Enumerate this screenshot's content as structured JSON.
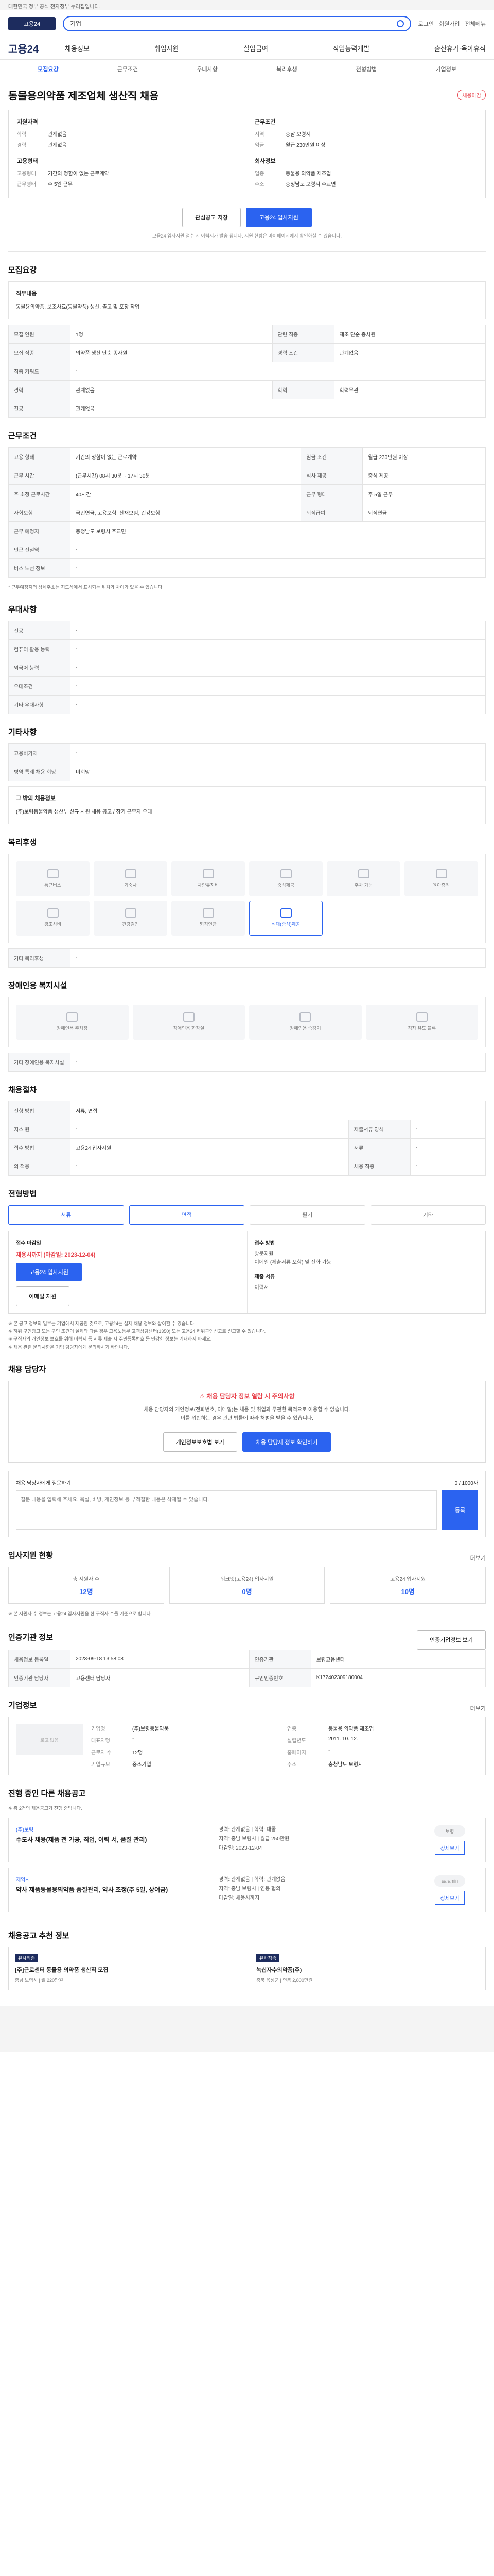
{
  "topbar": {
    "text": "대한민국 정부 공식 전자정부 누리집입니다."
  },
  "header": {
    "logo": "고용24",
    "search_value": "기업",
    "links": [
      "로그인",
      "회원가입",
      "전체메뉴"
    ]
  },
  "gnb": {
    "brand": "고용24",
    "menu": [
      "채용정보",
      "취업지원",
      "실업급여",
      "직업능력개발",
      "출산휴가·육아휴직"
    ]
  },
  "subnav": [
    "모집요강",
    "근무조건",
    "우대사항",
    "복리후생",
    "전형방법",
    "기업정보"
  ],
  "job": {
    "title": "동물용의약품 제조업체 생산직 채용",
    "badge": "채용마감",
    "company": {
      "label1": "지원자격",
      "edu_k": "학력",
      "edu_v": "관계없음",
      "career_k": "경력",
      "career_v": "관계없음",
      "label2": "근무조건",
      "region_k": "지역",
      "region_v": "충남 보령시",
      "salary_k": "임금",
      "salary_v": "월급 230만원 이상",
      "label3": "고용형태",
      "type_k": "고용형태",
      "type_v": "기간의 정함이 없는 근로계약",
      "time_k": "근무형태",
      "time_v": "주 5일 근무",
      "label4": "회사정보",
      "biz_k": "업종",
      "biz_v": "동물용 의약품 제조업",
      "addr_k": "주소",
      "addr_v": "충청남도 보령시 주교면"
    },
    "btn_save": "관심공고 저장",
    "btn_apply": "고용24 입사지원",
    "note": "고용24 입사지원 접수 시 이력서가 발송 됩니다. 지원 현황은 마이페이지에서 확인하실 수 있습니다."
  },
  "sec_recruit": {
    "title": "모집요강",
    "job_title_k": "직무내용",
    "job_desc": "동물용의약품, 보조사료(동물약품) 생산, 출고 및 포장 작업",
    "rows": [
      {
        "k": "모집 인원",
        "v": "1명",
        "k2": "관련 직종",
        "v2": "제조 단순 종사원"
      },
      {
        "k": "모집 직종",
        "v": "의약품 생산 단순 종사원",
        "k2": "경력 조건",
        "v2": "관계없음"
      },
      {
        "k": "직종 키워드",
        "v": "-",
        "k2": "",
        "v2": ""
      },
      {
        "k": "경력",
        "v": "관계없음",
        "k2": "학력",
        "v2": "학력무관"
      },
      {
        "k": "전공",
        "v": "관계없음",
        "k2": "",
        "v2": ""
      }
    ]
  },
  "sec_work": {
    "title": "근무조건",
    "rows": [
      {
        "k": "고용 형태",
        "v": "기간의 정함이 없는 근로계약",
        "k2": "임금 조건",
        "v2": "월급 230만원 이상"
      },
      {
        "k": "근무 시간",
        "v": "(근무시간) 08시 30분 ~ 17시 30분",
        "k2": "식사 제공",
        "v2": "중식 제공"
      },
      {
        "k": "주 소정 근로시간",
        "v": "40시간",
        "k2": "근무 형태",
        "v2": "주 5일 근무"
      },
      {
        "k": "사회보험",
        "v": "국민연금, 고용보험, 산재보험, 건강보험",
        "k2": "퇴직급여",
        "v2": "퇴직연금"
      },
      {
        "k": "근무 예정지",
        "v": "충청남도 보령시 주교면",
        "k2": "",
        "v2": ""
      },
      {
        "k": "인근 전철역",
        "v": "-",
        "k2": "",
        "v2": ""
      },
      {
        "k": "버스 노선 정보",
        "v": "-",
        "k2": "",
        "v2": ""
      }
    ],
    "note": "* 근무예정지의 상세주소는 지도상에서 표시되는 위치와 차이가 있을 수 있습니다."
  },
  "sec_prefer": {
    "title": "우대사항",
    "rows": [
      {
        "k": "전공",
        "v": "-"
      },
      {
        "k": "컴퓨터 활용 능력",
        "v": "-"
      },
      {
        "k": "외국어 능력",
        "v": "-"
      },
      {
        "k": "우대조건",
        "v": "-"
      },
      {
        "k": "기타 우대사항",
        "v": "-"
      }
    ]
  },
  "sec_etc": {
    "title": "기타사항",
    "rows": [
      {
        "k": "고용허가제",
        "v": "-"
      },
      {
        "k": "병역 특례 채용 희망",
        "v": "미희망"
      }
    ],
    "desc_title": "그 밖의 채용정보",
    "desc": "(주)보령동물약품 생산부 신규 사원 채용 공고 / 장기 근무자 우대"
  },
  "sec_welfare": {
    "title": "복리후생",
    "items": [
      {
        "label": "통근버스",
        "on": false
      },
      {
        "label": "기숙사",
        "on": false
      },
      {
        "label": "차량유지비",
        "on": false
      },
      {
        "label": "중식제공",
        "on": false
      },
      {
        "label": "주차 가능",
        "on": false
      },
      {
        "label": "육아휴직",
        "on": false
      },
      {
        "label": "경조사비",
        "on": false
      },
      {
        "label": "건강검진",
        "on": false
      },
      {
        "label": "퇴직연금",
        "on": false
      },
      {
        "label": "식대(중식)제공",
        "on": true
      }
    ],
    "etc_k": "기타 복리후생",
    "etc_v": "-"
  },
  "sec_barrier": {
    "title": "장애인용 복지시설",
    "items": [
      "장애인용 주차장",
      "장애인용 화장실",
      "장애인용 승강기",
      "점자 유도 블록"
    ],
    "etc_k": "기타 장애인용 복지시설",
    "etc_v": "-"
  },
  "sec_method": {
    "title": "채용절차",
    "rows": [
      {
        "k": "전형 방법",
        "v": "서류, 면접",
        "k2": "",
        "v2": ""
      },
      {
        "k": "지스 원",
        "v": "-",
        "k2": "제출서류 양식",
        "v2": "-"
      },
      {
        "k": "접수 방법",
        "v": "고용24 입사지원",
        "k2": "서류",
        "v2": "-"
      },
      {
        "k": "의 적응",
        "v": "-",
        "k2": "채용 직종",
        "v2": "-"
      }
    ]
  },
  "sec_apply": {
    "title": "전형방법",
    "methods": [
      "서류",
      "면접",
      "필기",
      "기타"
    ],
    "method_on": [
      true,
      true,
      false,
      false
    ],
    "col1_label": "접수 마감일",
    "col1_red": "채용시까지 (마감일: 2023-12-04)",
    "col1_btn": "고용24 입사지원",
    "col1_btn2": "이메일 지원",
    "col2_label": "접수 방법",
    "col2_v1": "방문지원",
    "col2_v2": "이메일 (제출서류 포함) 및 전화 가능",
    "col2_label2": "제출 서류",
    "col2_v3": "이력서"
  },
  "notes": [
    "※ 본 공고 정보의 일부는 기업에서 제공한 것으로, 고용24는 실제 채용 정보와 상이할 수 있습니다.",
    "※ 허위 구인광고 또는 구인 조건이 실제와 다른 경우 고용노동부 고객상담센터(1350) 또는 고용24 허위구인신고로 신고할 수 있습니다.",
    "※ 구직자의 개인정보 보호를 위해 이력서 등 서류 제출 시 주민등록번호 등 민감한 정보는 기재하지 마세요.",
    "※ 채용 관련 문의사항은 기업 담당자에게 문의하시기 바랍니다."
  ],
  "sec_contact": {
    "title": "채용 담당자",
    "warn": "채용 담당자 정보 열람 시 주의사항",
    "txt1": "채용 담당자의 개인정보(전화번호, 이메일)는 채용 및 취업과 무관한 목적으로 이용할 수 없습니다.",
    "txt2": "이를 위반하는 경우 관련 법률에 따라 처벌을 받을 수 있습니다.",
    "btn1": "개인정보보호법 보기",
    "btn2": "채용 담당자 정보 확인하기",
    "qna_title": "채용 담당자에게 질문하기",
    "qna_count": "0 / 1000자",
    "qna_placeholder": "질문 내용을 입력해 주세요. 욕설, 비방, 개인정보 등 부적절한 내용은 삭제될 수 있습니다.",
    "qna_btn": "등록"
  },
  "sec_stats": {
    "title": "입사지원 현황",
    "more": "더보기",
    "cards": [
      {
        "l": "총 지원자 수",
        "n": "12명"
      },
      {
        "l": "워크넷(고용24) 입사지원",
        "n": "0명"
      },
      {
        "l": "고용24 입사지원",
        "n": "10명"
      }
    ],
    "note": "※ 본 지원자 수 정보는 고용24 입사지원을 한 구직자 수를 기준으로 합니다."
  },
  "sec_info": {
    "title": "인증기관 정보",
    "btn": "인증기업정보 보기",
    "rows": [
      {
        "k": "채용정보 등록일",
        "v": "2023-09-18 13:58:08",
        "k2": "인증기관",
        "v2": "보령고용센터"
      },
      {
        "k": "인증기관 담당자",
        "v": "고용센터 담당자",
        "k2": "구인인증번호",
        "v2": "K172402309180004"
      }
    ]
  },
  "sec_company": {
    "title": "기업정보",
    "more": "더보기",
    "logo_alt": "로고 없음",
    "items": [
      {
        "k": "기업명",
        "v": "(주)보령동물약품"
      },
      {
        "k": "업종",
        "v": "동물용 의약품 제조업"
      },
      {
        "k": "대표자명",
        "v": "-"
      },
      {
        "k": "설립년도",
        "v": "2011. 10. 12."
      },
      {
        "k": "근로자 수",
        "v": "12명"
      },
      {
        "k": "홈페이지",
        "v": "-"
      },
      {
        "k": "기업규모",
        "v": "중소기업"
      },
      {
        "k": "주소",
        "v": "충청남도 보령시"
      }
    ]
  },
  "sec_other": {
    "title": "진행 중인 다른 채용공고",
    "note": "※ 총 2건의 채용공고가 진행 중입니다.",
    "jobs": [
      {
        "org": "(주)보령",
        "title": "수도사 채용(제품 전 가공, 직업, 이력 서, 품질 관리)",
        "meta1": "경력: 관계없음  |  학력: 대졸",
        "meta2": "지역: 충남 보령시  |  월급 250만원",
        "meta3": "마감일: 2023-12-04",
        "logo": "보령",
        "btn": "상세보기"
      },
      {
        "org": "제약사",
        "title": "약사 제품동물용의약품 품질관리, 약사 조정(주 5일, 상여금)",
        "meta1": "경력: 관계없음  |  학력: 관계없음",
        "meta2": "지역: 충남 보령시  |  연봉 협의",
        "meta3": "마감일: 채용시까지",
        "logo": "saramin",
        "btn": "상세보기"
      }
    ]
  },
  "sec_reco": {
    "title": "채용공고 추천 정보",
    "cards": [
      {
        "tag": "유사직종",
        "title": "[주]근로센터 동물용 의약품 생산직 모집",
        "meta": "충남 보령시 | 월 220만원"
      },
      {
        "tag": "유사직종",
        "title": "녹십자수의약품(주)",
        "meta": "충북 음성군 | 연봉 2,800만원"
      }
    ]
  }
}
